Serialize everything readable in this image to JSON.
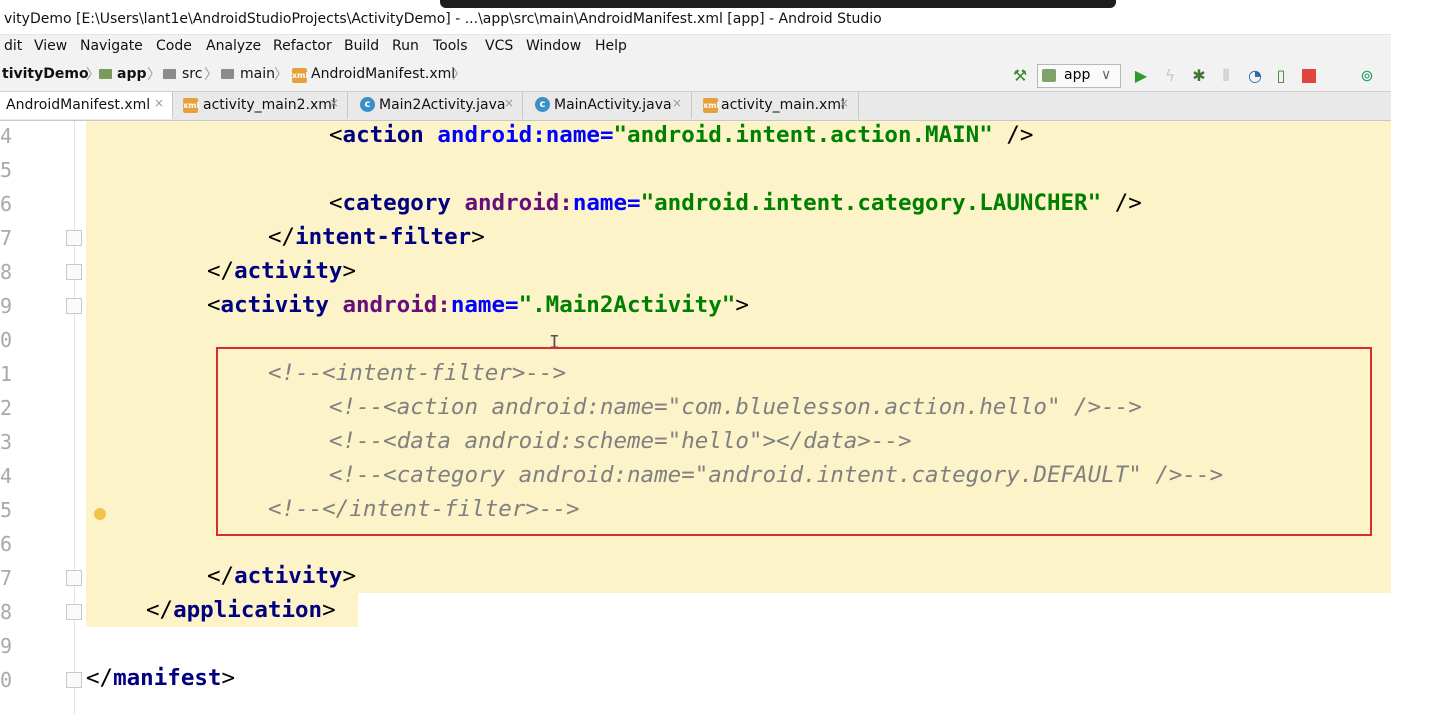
{
  "window": {
    "title": "vityDemo [E:\\Users\\lant1e\\AndroidStudioProjects\\ActivityDemo] - ...\\app\\src\\main\\AndroidManifest.xml [app] - Android Studio"
  },
  "menu": [
    "dit",
    "View",
    "Navigate",
    "Code",
    "Analyze",
    "Refactor",
    "Build",
    "Run",
    "Tools",
    "VCS",
    "Window",
    "Help"
  ],
  "breadcrumb": [
    "tivityDemo",
    "app",
    "src",
    "main",
    "AndroidManifest.xml"
  ],
  "toolbar": {
    "run_config": "app",
    "run_config_arrow": "∨"
  },
  "tabs": [
    {
      "label": "AndroidManifest.xml",
      "icon": "xml-file-icon",
      "active": true
    },
    {
      "label": "activity_main2.xml",
      "icon": "layout-xml-icon"
    },
    {
      "label": "Main2Activity.java",
      "icon": "java-class-icon"
    },
    {
      "label": "MainActivity.java",
      "icon": "java-class-icon"
    },
    {
      "label": "activity_main.xml",
      "icon": "layout-xml-icon"
    }
  ],
  "editor": {
    "line_numbers": [
      "4",
      "5",
      "6",
      "7",
      "8",
      "9",
      "0",
      "1",
      "2",
      "3",
      "4",
      "5",
      "6",
      "7",
      "8",
      "9",
      "0"
    ],
    "code": {
      "l14_open": "<",
      "l14_tag": "action",
      "l14_ns": "android:",
      "l14_attr": "name",
      "l14_eq": "=",
      "l14_val": "\"android.intent.action.MAIN\"",
      "l14_close": " />",
      "l16_open": "<",
      "l16_tag": "category",
      "l16_ns": "android:",
      "l16_attr": "name",
      "l16_eq": "=",
      "l16_val": "\"android.intent.category.LAUNCHER\"",
      "l16_close": " />",
      "l17_open": "</",
      "l17_tag": "intent-filter",
      "l17_close": ">",
      "l18_open": "</",
      "l18_tag": "activity",
      "l18_close": ">",
      "l19_open": "<",
      "l19_tag": "activity",
      "l19_ns": "android:",
      "l19_attr": "name",
      "l19_eq": "=",
      "l19_val": "\".Main2Activity\"",
      "l19_close": ">",
      "c21": "<!--<intent-filter>-->",
      "c22": "<!--<action android:name=\"com.bluelesson.action.hello\" />-->",
      "c23": "<!--<data android:scheme=\"hello\"></data>-->",
      "c24": "<!--<category android:name=\"android.intent.category.DEFAULT\" />-->",
      "c25": "<!--</intent-filter>-->",
      "l27_open": "</",
      "l27_tag": "activity",
      "l27_close": ">",
      "l28_open": "</",
      "l28_tag": "application",
      "l28_close": ">",
      "l30_open": "</",
      "l30_tag": "manifest",
      "l30_close": ">"
    }
  },
  "colors": {
    "tag": "#000080",
    "attribute": "#660e7a",
    "namespace": "#0000ff",
    "string": "#008000",
    "comment": "#808080",
    "highlight": "#fcf3c8",
    "annotation_box": "#d62e2e"
  }
}
